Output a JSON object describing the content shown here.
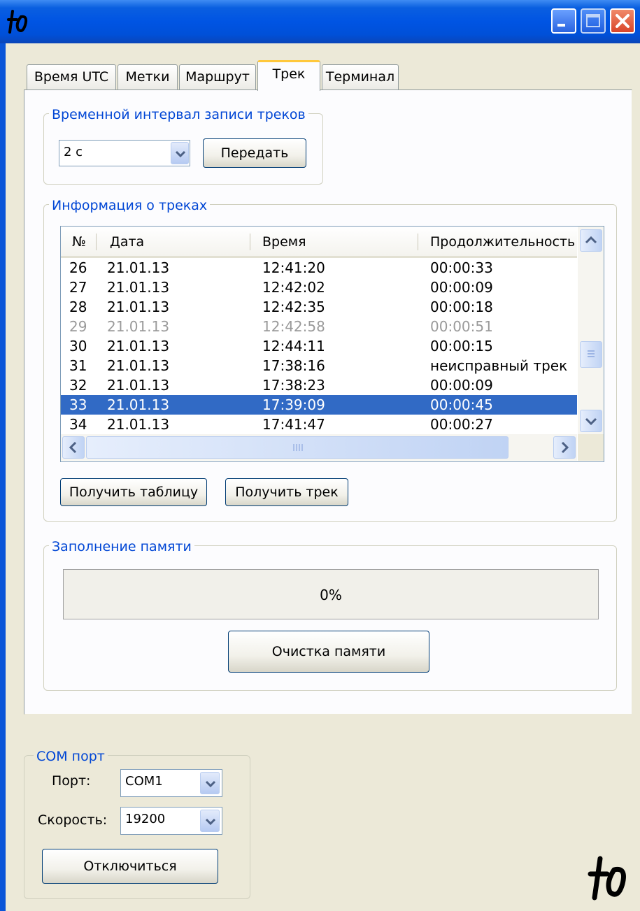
{
  "tabs": [
    "Время UTC",
    "Метки",
    "Маршрут",
    "Трек",
    "Терминал"
  ],
  "active_tab": "Трек",
  "interval_group": {
    "title": "Временной интервал записи треков",
    "combo_value": "2 c",
    "send_button": "Передать"
  },
  "tracks_group": {
    "title": "Информация о треках",
    "columns": [
      "№",
      "Дата",
      "Время",
      "Продолжительность"
    ],
    "rows": [
      {
        "n": "26",
        "date": "21.01.13",
        "time": "12:41:20",
        "dur": "00:00:33"
      },
      {
        "n": "27",
        "date": "21.01.13",
        "time": "12:42:02",
        "dur": "00:00:09"
      },
      {
        "n": "28",
        "date": "21.01.13",
        "time": "12:42:35",
        "dur": "00:00:18"
      },
      {
        "n": "29",
        "date": "21.01.13",
        "time": "12:42:58",
        "dur": "00:00:51"
      },
      {
        "n": "30",
        "date": "21.01.13",
        "time": "12:44:11",
        "dur": "00:00:15"
      },
      {
        "n": "31",
        "date": "21.01.13",
        "time": "17:38:16",
        "dur": "неисправный трек"
      },
      {
        "n": "32",
        "date": "21.01.13",
        "time": "17:38:23",
        "dur": "00:00:09"
      },
      {
        "n": "33",
        "date": "21.01.13",
        "time": "17:39:09",
        "dur": "00:00:45"
      },
      {
        "n": "34",
        "date": "21.01.13",
        "time": "17:41:47",
        "dur": "00:00:27"
      }
    ],
    "get_table_button": "Получить таблицу",
    "get_track_button": "Получить трек"
  },
  "memory_group": {
    "title": "Заполнение памяти",
    "progress_text": "0%",
    "progress_value": 0,
    "clear_button": "Очистка памяти"
  },
  "com_group": {
    "title": "COM порт",
    "port_label": "Порт:",
    "port_value": "COM1",
    "speed_label": "Скорость:",
    "speed_value": "19200",
    "disconnect_button": "Отключиться"
  },
  "colors": {
    "titlebar": "#0054e3",
    "group_title": "#0046d5",
    "selection": "#316ac5",
    "active_tab_accent": "#ffc83c"
  }
}
